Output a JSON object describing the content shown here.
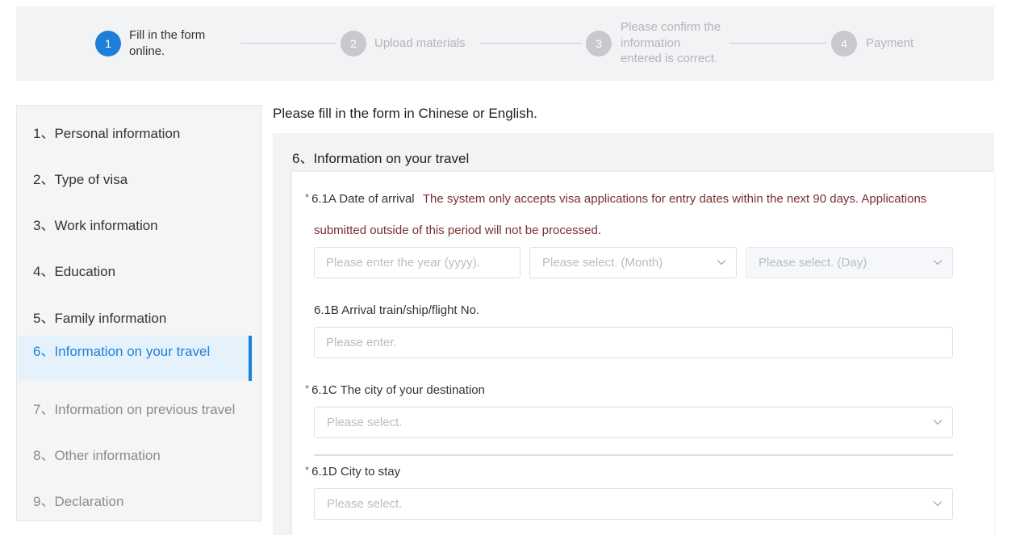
{
  "stepper": {
    "steps": [
      {
        "number": "1",
        "label_line1": "Fill in the form",
        "label_line2": "online.",
        "label_line3": "",
        "active": true
      },
      {
        "number": "2",
        "label_line1": "Upload materials",
        "label_line2": "",
        "label_line3": "",
        "active": false
      },
      {
        "number": "3",
        "label_line1": "Please confirm the",
        "label_line2": "information",
        "label_line3": "entered is correct.",
        "active": false
      },
      {
        "number": "4",
        "label_line1": "Payment",
        "label_line2": "",
        "label_line3": "",
        "active": false
      }
    ]
  },
  "sidebar": {
    "items": [
      {
        "label": "1、Personal information",
        "state": "normal"
      },
      {
        "label": "2、Type of visa",
        "state": "normal"
      },
      {
        "label": "3、Work information",
        "state": "normal"
      },
      {
        "label": "4、Education",
        "state": "normal"
      },
      {
        "label": "5、Family information",
        "state": "normal"
      },
      {
        "label": "6、Information on your travel",
        "state": "active"
      },
      {
        "label": "7、Information on previous travel",
        "state": "disabled"
      },
      {
        "label": "8、Other information",
        "state": "disabled"
      },
      {
        "label": "9、Declaration",
        "state": "disabled"
      }
    ],
    "active_color": "#1e7fd8"
  },
  "main": {
    "intro": "Please fill in the form in Chinese or English.",
    "section_title": "6、Information on your travel",
    "fields": {
      "arrival_date": {
        "required_mark": "*",
        "label": "6.1A Date of arrival",
        "note_line1": "The system only accepts visa applications for entry dates within the next 90 days. Applications",
        "note_line2": "submitted outside of this period will not be processed.",
        "year_placeholder": "Please enter the year (yyyy).",
        "month_placeholder": "Please select. (Month)",
        "day_placeholder": "Please select. (Day)"
      },
      "arrival_flight": {
        "label": "6.1B Arrival train/ship/flight No.",
        "placeholder": "Please enter."
      },
      "destination_city": {
        "required_mark": "*",
        "label": "6.1C The city of your destination",
        "placeholder": "Please select."
      },
      "city_to_stay": {
        "required_mark": "*",
        "label": "6.1D City to stay",
        "placeholder": "Please select."
      }
    },
    "note_color": "#7a2f35"
  },
  "icons": {
    "select_arrow": "chevron-down-icon"
  }
}
